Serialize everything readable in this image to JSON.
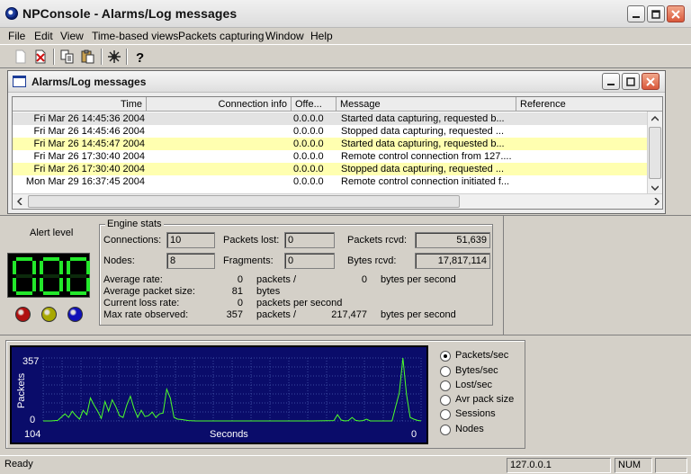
{
  "window": {
    "title": "NPConsole - Alarms/Log messages"
  },
  "menu": [
    "File",
    "Edit",
    "View",
    "Time-based views",
    "Packets capturing",
    "Window",
    "Help"
  ],
  "toolbar": {
    "icons": [
      "new-document-icon",
      "delete-icon",
      "copy-icon",
      "paste-icon",
      "network-capture-icon",
      "help-icon"
    ]
  },
  "child": {
    "title": "Alarms/Log messages",
    "columns": [
      "Time",
      "Connection info",
      "Offe...",
      "Message",
      "Reference"
    ],
    "rows": [
      {
        "time": "Fri Mar 26 14:45:36 2004",
        "conn": "",
        "offset": "0.0.0.0",
        "message": "Started data capturing, requested b...",
        "ref": "",
        "highlight": "selected"
      },
      {
        "time": "Fri Mar 26 14:45:46 2004",
        "conn": "",
        "offset": "0.0.0.0",
        "message": "Stopped data capturing, requested ...",
        "ref": "",
        "highlight": "none"
      },
      {
        "time": "Fri Mar 26 14:45:47 2004",
        "conn": "",
        "offset": "0.0.0.0",
        "message": "Started data capturing, requested b...",
        "ref": "",
        "highlight": "yellow"
      },
      {
        "time": "Fri Mar 26 17:30:40 2004",
        "conn": "",
        "offset": "0.0.0.0",
        "message": "Remote control connection from 127....",
        "ref": "",
        "highlight": "none"
      },
      {
        "time": "Fri Mar 26 17:30:40 2004",
        "conn": "",
        "offset": "0.0.0.0",
        "message": "Stopped data capturing, requested ...",
        "ref": "",
        "highlight": "yellow"
      },
      {
        "time": "Mon Mar 29 16:37:45 2004",
        "conn": "",
        "offset": "0.0.0.0",
        "message": "Remote control connection initiated f...",
        "ref": "",
        "highlight": "none"
      }
    ]
  },
  "alert": {
    "label": "Alert level",
    "value": "000",
    "leds": [
      "#b01010",
      "#a8a800",
      "#1010b8"
    ]
  },
  "engine": {
    "label": "Engine stats",
    "connections_label": "Connections:",
    "connections": "10",
    "nodes_label": "Nodes:",
    "nodes": "8",
    "packets_lost_label": "Packets lost:",
    "packets_lost": "0",
    "fragments_label": "Fragments:",
    "fragments": "0",
    "packets_rcvd_label": "Packets rcvd:",
    "packets_rcvd": "51,639",
    "bytes_rcvd_label": "Bytes rcvd:",
    "bytes_rcvd": "17,817,114",
    "avg_rate_label": "Average rate:",
    "avg_rate_packets": "0",
    "avg_rate_packets_unit": "packets /",
    "avg_rate_bytes": "0",
    "avg_rate_bytes_unit": "bytes per second",
    "avg_size_label": "Average packet size:",
    "avg_size": "81",
    "avg_size_unit": "bytes",
    "loss_label": "Current loss rate:",
    "loss": "0",
    "loss_unit": "packets per second",
    "max_label": "Max rate observed:",
    "max_packets": "357",
    "max_packets_unit": "packets /",
    "max_bytes": "217,477",
    "max_bytes_unit": "bytes per second"
  },
  "chart_data": {
    "type": "line",
    "ylabel": "Packets",
    "xlabel": "Seconds",
    "ymax_label": "357",
    "ymin_label": "0",
    "xleft_label": "104",
    "xright_label": "0",
    "ylim": [
      0,
      357
    ],
    "xlim": [
      104,
      0
    ],
    "x": [
      104,
      102,
      100,
      98,
      97,
      96,
      95,
      94,
      93,
      92,
      91,
      90,
      89,
      88,
      87,
      86,
      85,
      84,
      83,
      82,
      81,
      80,
      79,
      78,
      77,
      76,
      75,
      74,
      73,
      72,
      71,
      70,
      69,
      68,
      67,
      66,
      65,
      64,
      62,
      60,
      50,
      40,
      30,
      24,
      23,
      22,
      21,
      20,
      19,
      18,
      17,
      16,
      15,
      14,
      12,
      10,
      8,
      7,
      6,
      5,
      4,
      3,
      2,
      1,
      0
    ],
    "values": [
      0,
      0,
      3,
      40,
      20,
      55,
      30,
      10,
      60,
      35,
      130,
      90,
      55,
      15,
      110,
      55,
      120,
      80,
      30,
      20,
      90,
      140,
      70,
      20,
      60,
      25,
      30,
      50,
      20,
      40,
      45,
      180,
      130,
      20,
      10,
      8,
      5,
      2,
      0,
      0,
      0,
      0,
      0,
      2,
      35,
      5,
      0,
      2,
      20,
      3,
      0,
      2,
      10,
      0,
      0,
      0,
      0,
      80,
      160,
      357,
      150,
      20,
      10,
      3,
      0
    ],
    "line_color": "#4cff2a",
    "grid": true
  },
  "modes": {
    "options": [
      "Packets/sec",
      "Bytes/sec",
      "Lost/sec",
      "Avr pack size",
      "Sessions",
      "Nodes"
    ],
    "selected": 0
  },
  "status": {
    "text": "Ready",
    "ip": "127.0.0.1",
    "num": "NUM"
  }
}
